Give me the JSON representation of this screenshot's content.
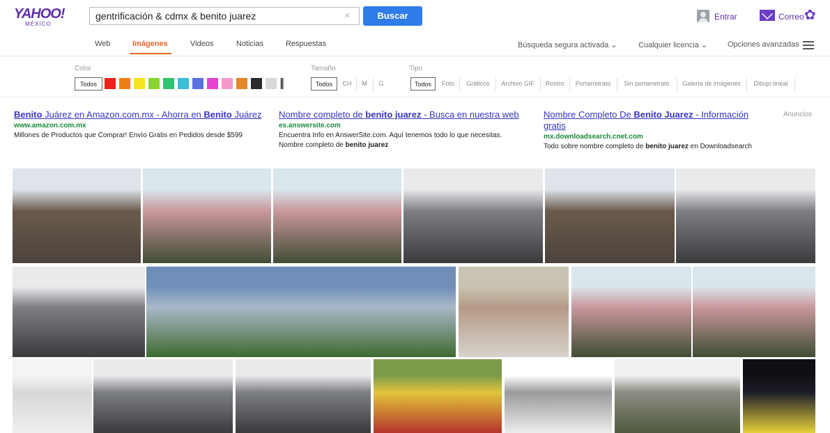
{
  "header": {
    "logo_text": "YAHOO!",
    "logo_region": "MÉXICO",
    "search_value": "gentrificación & cdmx & benito juarez",
    "clear_symbol": "×",
    "search_button": "Buscar",
    "signin_label": "Entrar",
    "mail_label": "Correo"
  },
  "tabs": [
    "Web",
    "Imágenes",
    "Videos",
    "Noticias",
    "Respuestas"
  ],
  "active_tab": "Imágenes",
  "right_options": {
    "safe_search": "Búsqueda segura activada ⌄",
    "license": "Cualquier licencia ⌄",
    "advanced": "Opciones avanzadas"
  },
  "filters": {
    "color_label": "Color",
    "color_all": "Todos",
    "swatches": [
      "#e8261b",
      "#f07e17",
      "#f5e322",
      "#8ad42a",
      "#2fc46e",
      "#3bbcd8",
      "#5a6fe0",
      "#e444cf",
      "#f29bc9",
      "#e1882a",
      "#2b2b2b",
      "#d9d9d9",
      "#ffffff"
    ],
    "size_label": "Tamaño",
    "sizes": [
      "Todos",
      "CH",
      "M",
      "G"
    ],
    "type_label": "Tipo",
    "types": [
      "Todos",
      "Foto",
      "Gráficos",
      "Archivo GIF",
      "Rostro",
      "Portarretrato",
      "Sin portarretrato",
      "Galería de imágenes",
      "Dibujo lineal"
    ]
  },
  "ads": {
    "label": "Anuncios",
    "items": [
      {
        "title_pre": "",
        "title_bold": "Benito",
        "title_post": " Juárez en Amazon.com.mx - Ahorra en ",
        "title_bold2": "Benito",
        "title_post2": " Juárez",
        "url": "www.amazon.com.mx",
        "desc": "Millones de Productos que Comprar! Envío Gratis en Pedidos desde $599"
      },
      {
        "title_pre": "Nombre completo de ",
        "title_bold": "benito juarez",
        "title_post": " - Busca en nuestra web",
        "title_bold2": "",
        "title_post2": "",
        "url": "es.answersite.com",
        "desc": "Encuentra Info en AnswerSite.com. Aquí tenemos todo lo que necesitas.",
        "desc2_pre": "Nombre completo de ",
        "desc2_bold": "benito juarez"
      },
      {
        "title_pre": "Nombre Completo De ",
        "title_bold": "Benito Juarez",
        "title_post": " - Información",
        "title_line2": "gratis",
        "url": "mx.downloadsearch.cnet.com",
        "desc_pre": "Todo sobre nombre completo de ",
        "desc_bold": "benito juarez",
        "desc_post": " en Downloadsearch"
      }
    ]
  },
  "images": {
    "row1": [
      {
        "name": "street-facades-photo",
        "sky": "#dfe4ea",
        "top": "#6a5a4c",
        "bottom": "#4c433c"
      },
      {
        "name": "pink-mansion-photo",
        "sky": "#d9e6ec",
        "top": "#c9979c",
        "bottom": "#3f4d35"
      },
      {
        "name": "pink-mansion-photo-2",
        "sky": "#d9e6ec",
        "top": "#c9979c",
        "bottom": "#3f4d35"
      },
      {
        "name": "grey-building-photo",
        "sky": "#e8eaec",
        "top": "#7d7f82",
        "bottom": "#3a3b3d"
      },
      {
        "name": "street-facades-photo-2",
        "sky": "#dfe4ea",
        "top": "#6a5a4c",
        "bottom": "#4c433c"
      },
      {
        "name": "grey-building-photo-2",
        "sky": "#e8eaec",
        "top": "#7d7f82",
        "bottom": "#3a3b3d"
      }
    ],
    "row2": [
      {
        "name": "grey-building-photo-3",
        "sky": "#e8eaec",
        "top": "#7d7f82",
        "bottom": "#3a3b3d"
      },
      {
        "name": "city-skyline-photo",
        "sky": "#6f8fb8",
        "top": "#a9b8c8",
        "bottom": "#3e6a2f"
      },
      {
        "name": "woman-with-book-photo",
        "sky": "#c9c3b4",
        "top": "#b59a86",
        "bottom": "#d6d2cc"
      },
      {
        "name": "pink-mansion-photo-3",
        "sky": "#d9e6ec",
        "top": "#c9979c",
        "bottom": "#3f4d35"
      },
      {
        "name": "pink-mansion-photo-4",
        "sky": "#d9e6ec",
        "top": "#c9979c",
        "bottom": "#3f4d35"
      }
    ],
    "row3": [
      {
        "name": "street-map-drawing",
        "sky": "#f4f4f4",
        "top": "#d8d8d8",
        "bottom": "#eeeeee"
      },
      {
        "name": "grey-building-photo-4",
        "sky": "#e8eaec",
        "top": "#7d7f82",
        "bottom": "#3a3b3d"
      },
      {
        "name": "grey-building-photo-5",
        "sky": "#e8eaec",
        "top": "#7d7f82",
        "bottom": "#3a3b3d"
      },
      {
        "name": "yellow-restaurant-photo",
        "sky": "#7c9a4a",
        "top": "#e2c43c",
        "bottom": "#b5342b"
      },
      {
        "name": "district-map-chart",
        "sky": "#ffffff",
        "top": "#9a9a9a",
        "bottom": "#ededed"
      },
      {
        "name": "historic-building-photo",
        "sky": "#eef0f1",
        "top": "#8c8c82",
        "bottom": "#4f5a3e"
      },
      {
        "name": "protest-banner-photo",
        "sky": "#101014",
        "top": "#1d1d2a",
        "bottom": "#e6d23a"
      }
    ]
  }
}
